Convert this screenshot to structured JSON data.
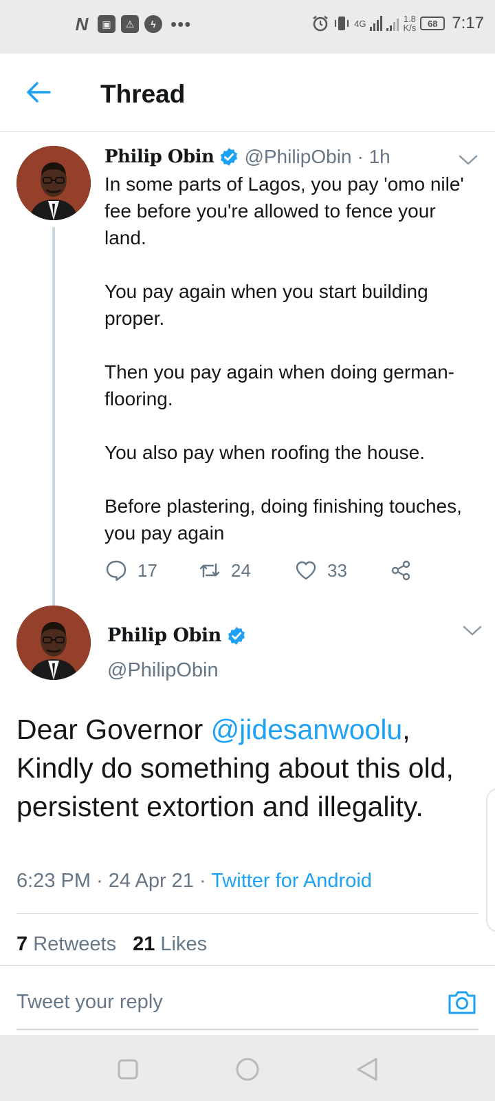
{
  "status_bar": {
    "left_icons": [
      "netflix-icon",
      "game-icon",
      "alert-icon",
      "messenger-icon"
    ],
    "more": "•••",
    "network": "4G",
    "speed_value": "1.8",
    "speed_unit": "K/s",
    "battery": "68",
    "time": "7:17"
  },
  "header": {
    "title": "Thread"
  },
  "parent_tweet": {
    "display_name": "Philip Obin",
    "handle": "@PhilipObin",
    "time": "· 1h",
    "paragraphs": [
      "In some parts of Lagos, you pay 'omo nile' fee before you're allowed to fence your land.",
      "You pay again when you start building proper.",
      "Then you pay again when doing german-flooring.",
      "You also pay when roofing the house.",
      "Before plastering, doing finishing touches, you pay again"
    ],
    "replies": "17",
    "retweets": "24",
    "likes": "33"
  },
  "main_tweet": {
    "display_name": "Philip Obin",
    "handle": "@PhilipObin",
    "text_before": "Dear Governor ",
    "mention": "@jidesanwoolu",
    "text_after": ", Kindly do something about this old, persistent extortion and illegality.",
    "timestamp": "6:23 PM · 24 Apr 21 · ",
    "source": "Twitter for Android",
    "retweet_count": "7",
    "retweet_label": "Retweets",
    "like_count": "21",
    "like_label": "Likes"
  },
  "reply": {
    "placeholder": "Tweet your reply"
  },
  "colors": {
    "accent": "#1da1f2",
    "secondary_text": "#657786",
    "primary_text": "#14171a",
    "system_bar": "#ebebeb"
  }
}
